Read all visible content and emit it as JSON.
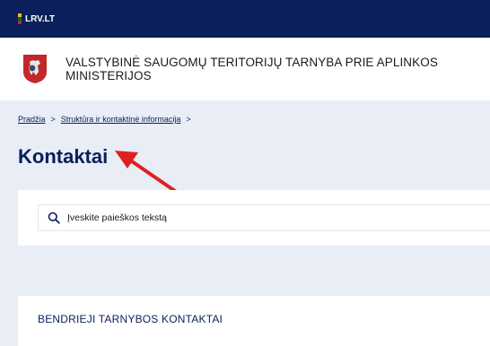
{
  "topbar": {
    "gov_link": "LRV.LT"
  },
  "header": {
    "institution_name": "VALSTYBINĖ SAUGOMŲ TERITORIJŲ TARNYBA PRIE APLINKOS MINISTERIJOS"
  },
  "breadcrumb": {
    "items": [
      "Pradžia",
      "Struktūra ir kontaktinė informacija"
    ],
    "separator": ">"
  },
  "page": {
    "title": "Kontaktai"
  },
  "search": {
    "placeholder": "Įveskite paieškos tekstą"
  },
  "section": {
    "heading": "BENDRIEJI TARNYBOS KONTAKTAI"
  },
  "colors": {
    "navy": "#0a1f5c",
    "page_bg": "#e8edf6",
    "arrow": "#e02020",
    "flag_yellow": "#fdb913",
    "flag_green": "#006a44",
    "flag_red": "#c1272d"
  },
  "icons": {
    "flag": "lithuanian-flag-icon",
    "coat": "coat-of-arms-icon",
    "search": "search-icon",
    "annotation": "red-arrow"
  }
}
